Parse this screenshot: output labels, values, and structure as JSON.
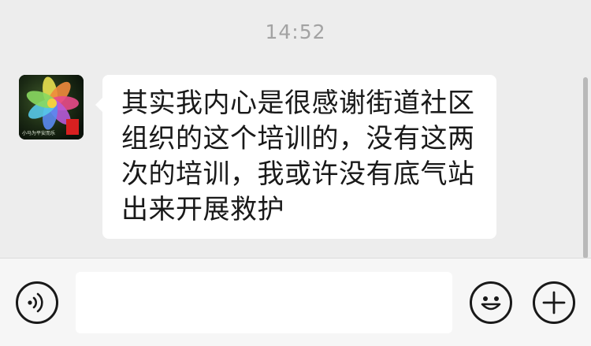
{
  "chat": {
    "timestamp": "14:52",
    "messages": [
      {
        "sender": "contact",
        "avatar_icon": "flower-avatar-icon",
        "avatar_caption": "小马为平安而乐",
        "text": "其实我内心是很感谢街道社区组织的这个培训的，没有这两次的培训，我或许没有底气站出来开展救护"
      }
    ]
  },
  "input_bar": {
    "voice_icon": "voice-icon",
    "input_value": "",
    "emoji_icon": "emoji-icon",
    "more_icon": "plus-icon"
  },
  "colors": {
    "chat_background": "#ededed",
    "bubble_background": "#ffffff",
    "timestamp_text": "#a3a3a3",
    "input_bar_background": "#f6f6f6",
    "icon_stroke": "#191919"
  }
}
